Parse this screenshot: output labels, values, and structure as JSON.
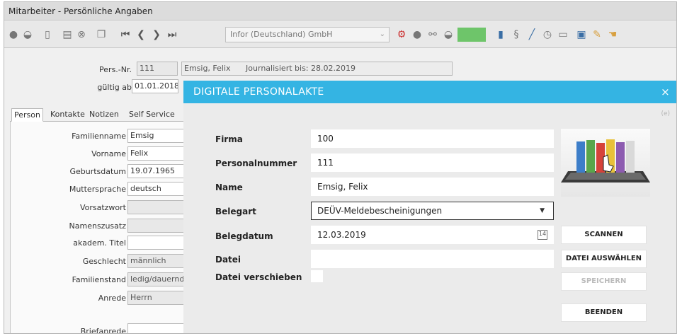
{
  "window": {
    "title": "Mitarbeiter - Persönliche Angaben"
  },
  "toolbar": {
    "company": "Infor (Deutschland) GmbH"
  },
  "header": {
    "persnr_label": "Pers.-Nr.",
    "persnr_value": "111",
    "name_value": "Emsig, Felix",
    "journal_label": "Journalisiert bis: 28.02.2019",
    "gueltig_label": "gültig ab",
    "gueltig_value": "01.01.2018"
  },
  "tabs": [
    "Person",
    "Kontakte",
    "Notizen",
    "Self Service"
  ],
  "person": {
    "familienname_label": "Familienname",
    "familienname": "Emsig",
    "vorname_label": "Vorname",
    "vorname": "Felix",
    "geburtsdatum_label": "Geburtsdatum",
    "geburtsdatum": "19.07.1965",
    "muttersprache_label": "Muttersprache",
    "muttersprache": "deutsch",
    "vorsatzwort_label": "Vorsatzwort",
    "vorsatzwort": "",
    "namenszusatz_label": "Namenszusatz",
    "namenszusatz": "",
    "titel_label": "akadem. Titel",
    "titel": "",
    "geschlecht_label": "Geschlecht",
    "geschlecht": "männlich",
    "familienstand_label": "Familienstand",
    "familienstand": "ledig/dauernd",
    "anrede_label": "Anrede",
    "anrede": "Herrn",
    "briefanrede_label": "Briefanrede",
    "briefanrede": ""
  },
  "modal": {
    "title": "DIGITALE PERSONALAKTE",
    "close": "×",
    "tag": "(e)",
    "firma_label": "Firma",
    "firma": "100",
    "personalnummer_label": "Personalnummer",
    "personalnummer": "111",
    "name_label": "Name",
    "name": "Emsig, Felix",
    "belegart_label": "Belegart",
    "belegart": "DEÜV-Meldebescheinigungen",
    "belegdatum_label": "Belegdatum",
    "belegdatum": "12.03.2019",
    "calendar_day": "14",
    "datei_label": "Datei",
    "datei": "",
    "verschieben_label": "Datei verschieben",
    "scannen": "SCANNEN",
    "datei_auswaehlen": "DATEI AUSWÄHLEN",
    "speichern": "SPEICHERN",
    "beenden": "BEENDEN"
  },
  "colors": {
    "accent": "#34b4e3",
    "green": "#6ec56a"
  }
}
